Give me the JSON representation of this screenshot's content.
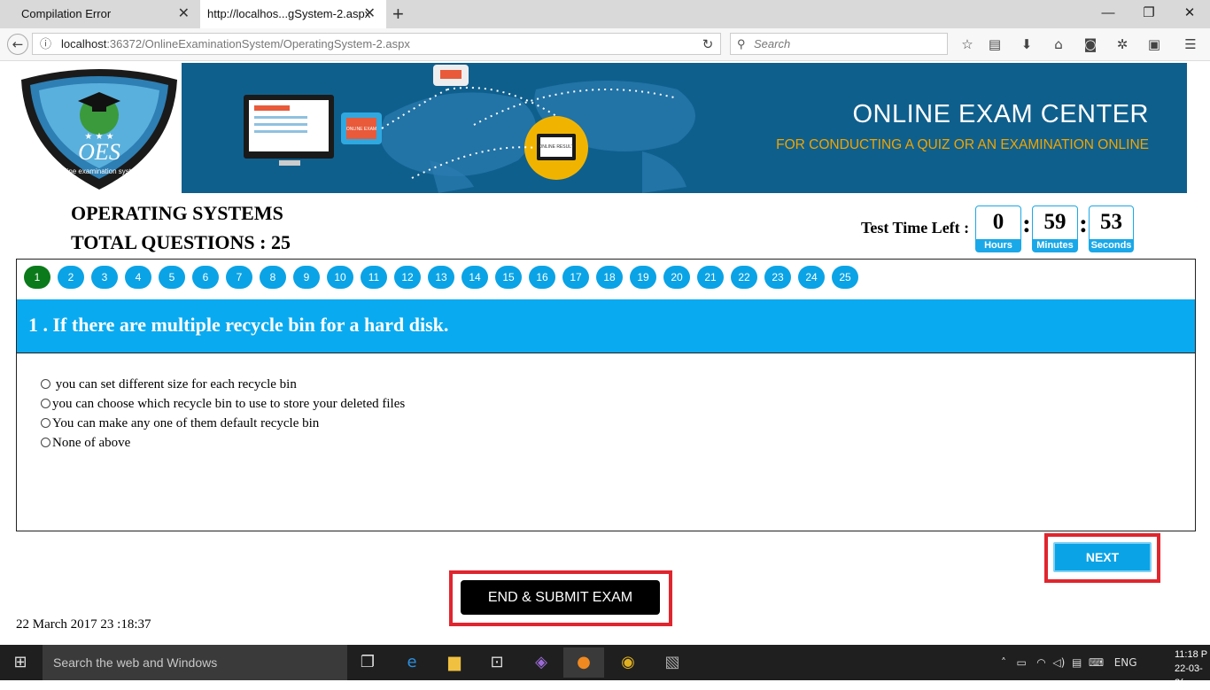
{
  "browser": {
    "tabs": [
      {
        "title": "Compilation Error"
      },
      {
        "title": "http://localhos...gSystem-2.aspx"
      }
    ],
    "url_host": "localhost",
    "url_rest": ":36372/OnlineExaminationSystem/OperatingSystem-2.aspx",
    "search_placeholder": "Search"
  },
  "banner": {
    "logo_text": "OES",
    "logo_subtext": "online examination system",
    "title": "ONLINE EXAM CENTER",
    "subtitle": "FOR CONDUCTING A QUIZ OR AN EXAMINATION ONLINE",
    "badge_exam": "ONLINE EXAM",
    "badge_result": "ONLINE RESULT"
  },
  "exam": {
    "subject": "OPERATING SYSTEMS",
    "total_questions": "TOTAL QUESTIONS : 25",
    "timer_label": "Test Time Left :",
    "timer": {
      "hours": "0",
      "minutes": "59",
      "seconds": "53",
      "hours_label": "Hours",
      "minutes_label": "Minutes",
      "seconds_label": "Seconds"
    },
    "question_numbers": [
      "1",
      "2",
      "3",
      "4",
      "5",
      "6",
      "7",
      "8",
      "9",
      "10",
      "11",
      "12",
      "13",
      "14",
      "15",
      "16",
      "17",
      "18",
      "19",
      "20",
      "21",
      "22",
      "23",
      "24",
      "25"
    ],
    "current_question": 1,
    "question": "1 . If there are multiple recycle bin for a hard disk.",
    "options": [
      " you can set different size for each recycle bin",
      "you can choose which recycle bin to use to store your deleted files",
      "You can make any one of them default recycle bin",
      "None of above"
    ],
    "next_label": "NEXT",
    "submit_label": "END & SUBMIT EXAM",
    "datetime": "22 March 2017 23 :18:37"
  },
  "taskbar": {
    "search_placeholder": "Search the web and Windows",
    "language": "ENG",
    "time": "11:18 P",
    "date": "22-03-2("
  },
  "colors": {
    "accent": "#0aa3e6",
    "active_question": "#0b7a1b",
    "banner_bg": "#0f5f8d",
    "highlight": "#e0252e"
  }
}
